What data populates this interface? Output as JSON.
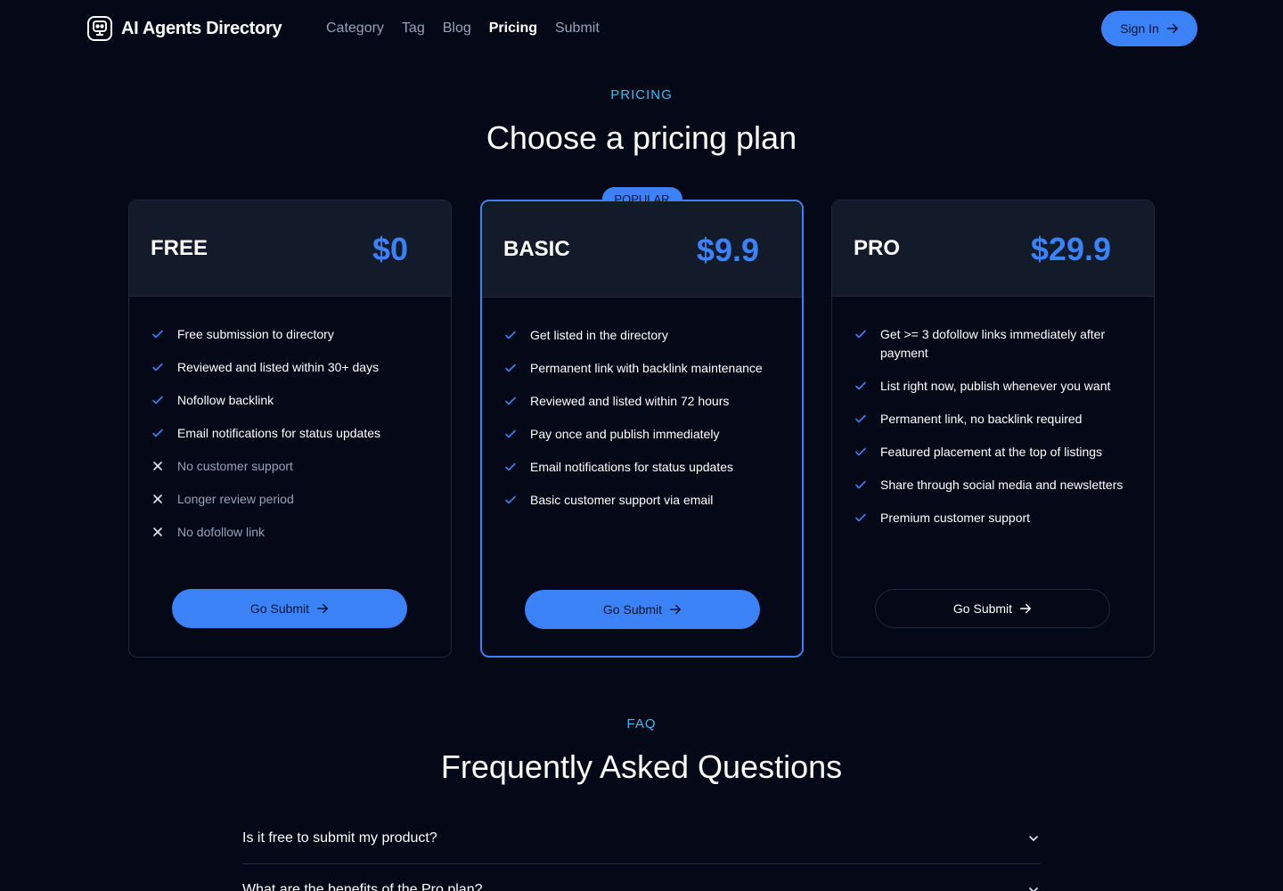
{
  "header": {
    "logo_text": "AI Agents Directory",
    "nav": [
      "Category",
      "Tag",
      "Blog",
      "Pricing",
      "Submit"
    ],
    "active_nav": "Pricing",
    "signin_label": "Sign In"
  },
  "pricing": {
    "eyebrow": "PRICING",
    "title": "Choose a pricing plan",
    "accent_color": "#3b82f6",
    "plans": [
      {
        "name": "FREE",
        "price": "$0",
        "badge": null,
        "button_label": "Go Submit",
        "button_style": "filled",
        "features": [
          {
            "text": "Free submission to directory",
            "included": true
          },
          {
            "text": "Reviewed and listed within 30+ days",
            "included": true
          },
          {
            "text": "Nofollow backlink",
            "included": true
          },
          {
            "text": "Email notifications for status updates",
            "included": true
          },
          {
            "text": "No customer support",
            "included": false
          },
          {
            "text": "Longer review period",
            "included": false
          },
          {
            "text": "No dofollow link",
            "included": false
          }
        ]
      },
      {
        "name": "BASIC",
        "price": "$9.9",
        "badge": "POPULAR",
        "button_label": "Go Submit",
        "button_style": "filled",
        "features": [
          {
            "text": "Get listed in the directory",
            "included": true
          },
          {
            "text": "Permanent link with backlink maintenance",
            "included": true
          },
          {
            "text": "Reviewed and listed within 72 hours",
            "included": true
          },
          {
            "text": "Pay once and publish immediately",
            "included": true
          },
          {
            "text": "Email notifications for status updates",
            "included": true
          },
          {
            "text": "Basic customer support via email",
            "included": true
          }
        ]
      },
      {
        "name": "PRO",
        "price": "$29.9",
        "badge": null,
        "button_label": "Go Submit",
        "button_style": "outline",
        "features": [
          {
            "text": "Get >= 3 dofollow links immediately after payment",
            "included": true
          },
          {
            "text": "List right now, publish whenever you want",
            "included": true
          },
          {
            "text": "Permanent link, no backlink required",
            "included": true
          },
          {
            "text": "Featured placement at the top of listings",
            "included": true
          },
          {
            "text": "Share through social media and newsletters",
            "included": true
          },
          {
            "text": "Premium customer support",
            "included": true
          }
        ]
      }
    ]
  },
  "faq": {
    "eyebrow": "FAQ",
    "title": "Frequently Asked Questions",
    "items": [
      "Is it free to submit my product?",
      "What are the benefits of the Pro plan?"
    ]
  }
}
